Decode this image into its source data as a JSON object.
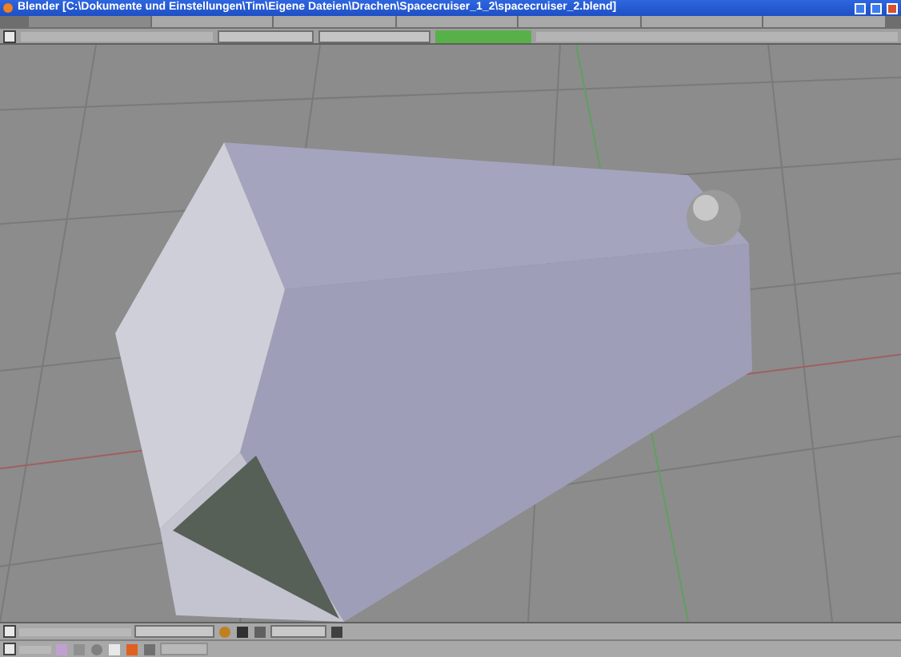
{
  "window": {
    "title": "Blender [C:\\Dokumente und Einstellungen\\Tim\\Eigene Dateien\\Drachen\\Spacecruiser_1_2\\spacecruiser_2.blend]"
  },
  "screen_tabs": [
    {
      "selected": true
    },
    {
      "selected": false
    },
    {
      "selected": false
    },
    {
      "selected": false
    },
    {
      "selected": false
    },
    {
      "selected": false
    },
    {
      "selected": false
    }
  ]
}
